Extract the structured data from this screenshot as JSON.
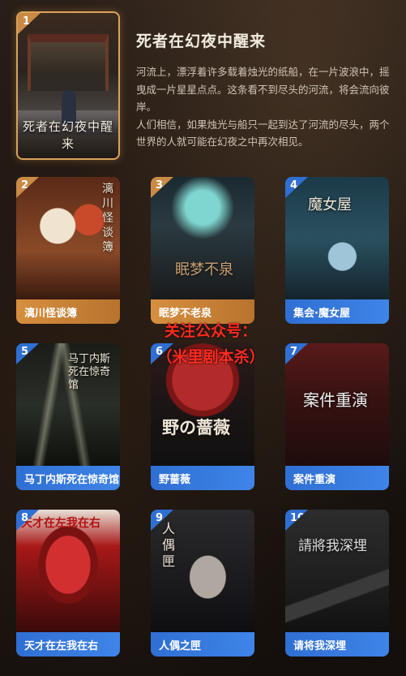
{
  "featured": {
    "number": "1",
    "poster_title": "死者在幻夜中醒来",
    "title": "死者在幻夜中醒来",
    "description": [
      "河流上，漂浮着许多载着烛光的纸船，在一片波浪中，摇曳成一片星星点点。这条看不到尽头的河流，将会流向彼岸。",
      "人们相信，如果烛光与船只一起到达了河流的尽头，两个世界的人就可能在幻夜之中再次相见。"
    ]
  },
  "cards": [
    {
      "number": "2",
      "label": "漓川怪谈簿",
      "poster_text": "漓川怪谈簿"
    },
    {
      "number": "3",
      "label": "眠梦不老泉",
      "poster_text": "眠梦不泉"
    },
    {
      "number": "4",
      "label": "集会·魔女屋",
      "poster_text": "魔女屋"
    },
    {
      "number": "5",
      "label": "马丁内斯死在惊奇馆",
      "poster_text": "马丁内斯死在惊奇馆"
    },
    {
      "number": "6",
      "label": "野蔷薇",
      "poster_text": "野の蔷薇"
    },
    {
      "number": "7",
      "label": "案件重演",
      "poster_text": "案件重演"
    },
    {
      "number": "8",
      "label": "天才在左我在右",
      "poster_text": "天才在左我在右"
    },
    {
      "number": "9",
      "label": "人偶之匣",
      "poster_text": "人偶匣"
    },
    {
      "number": "10",
      "label": "请将我深埋",
      "poster_text": "請將我深埋"
    }
  ],
  "watermark": {
    "line1": "关注公众号：",
    "line2": "（米里剧本杀）"
  },
  "colors": {
    "orange_accent": "#d68f3f",
    "blue_accent": "#2f6fd3",
    "watermark_red": "#ff2a1f"
  }
}
